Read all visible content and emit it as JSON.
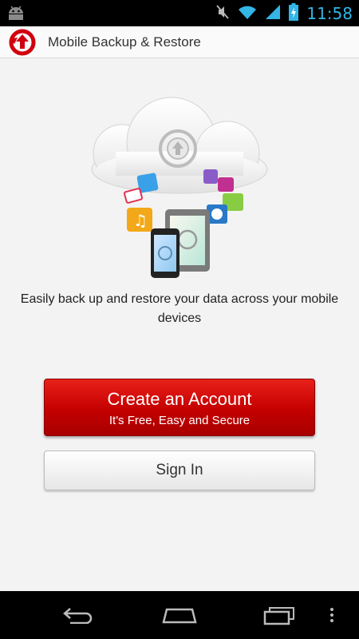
{
  "status_bar": {
    "time": "11:58",
    "icons": [
      "android-notification-icon",
      "mute-icon",
      "wifi-icon",
      "signal-icon",
      "battery-icon"
    ]
  },
  "action_bar": {
    "title": "Mobile Backup & Restore",
    "logo_icon": "backup-restore-logo-icon"
  },
  "main": {
    "tagline": "Easily back up and restore your data across your mobile devices",
    "create_account": {
      "label": "Create an Account",
      "sublabel": "It's Free, Easy and Secure"
    },
    "sign_in": {
      "label": "Sign In"
    }
  },
  "nav_bar": {
    "icons": [
      "back-icon",
      "home-icon",
      "recents-icon",
      "menu-icon"
    ]
  },
  "colors": {
    "accent_red": "#c40000",
    "time_blue": "#33b5e5"
  }
}
